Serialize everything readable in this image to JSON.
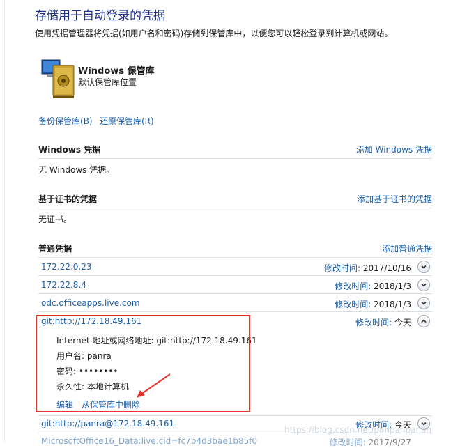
{
  "header": {
    "title": "存储用于自动登录的凭据",
    "description": "使用凭据管理器将凭据(如用户名和密码)存储到保管库中，以便您可以轻松登录到计算机或网站。"
  },
  "vault": {
    "name": "Windows 保管库",
    "subtitle": "默认保管库位置",
    "icon": "vault-icon"
  },
  "actions": {
    "backup": "备份保管库(B)",
    "restore": "还原保管库(R)"
  },
  "windows_creds": {
    "title": "Windows 凭据",
    "add": "添加 Windows 凭据",
    "empty": "无 Windows 凭据。"
  },
  "cert_creds": {
    "title": "基于证书的凭据",
    "add": "添加基于证书的凭据",
    "empty": "无证书。"
  },
  "generic_creds": {
    "title": "普通凭据",
    "add": "添加普通凭据",
    "modified_label": "修改时间:",
    "items": [
      {
        "name": "172.22.0.23",
        "modified": "2017/10/16"
      },
      {
        "name": "172.22.8.4",
        "modified": "2018/1/3"
      },
      {
        "name": "odc.officeapps.live.com",
        "modified": "2018/1/3"
      },
      {
        "name": "git:http://172.18.49.161",
        "modified": "今天"
      },
      {
        "name": "git:http://panra@172.18.49.161",
        "modified": "今天"
      },
      {
        "name": "MicrosoftOffice16_Data:live:cid=fc7b4d3bae1b85f0",
        "modified": "2017/9/27"
      }
    ],
    "expanded": {
      "address_label": "Internet 地址或网络地址:",
      "address_value": "git:http://172.18.49.161",
      "username_label": "用户名:",
      "username_value": "panra",
      "password_label": "密码:",
      "password_value": "••••••••",
      "persistence_label": "永久性:",
      "persistence_value": "本地计算机",
      "edit": "编辑",
      "remove": "从保管库中删除"
    }
  },
  "watermark": "https://blog.csdn.net/panpanpanan",
  "colors": {
    "title": "#1e3287",
    "link": "#1c5fa8",
    "highlight_box": "#e8332c"
  }
}
